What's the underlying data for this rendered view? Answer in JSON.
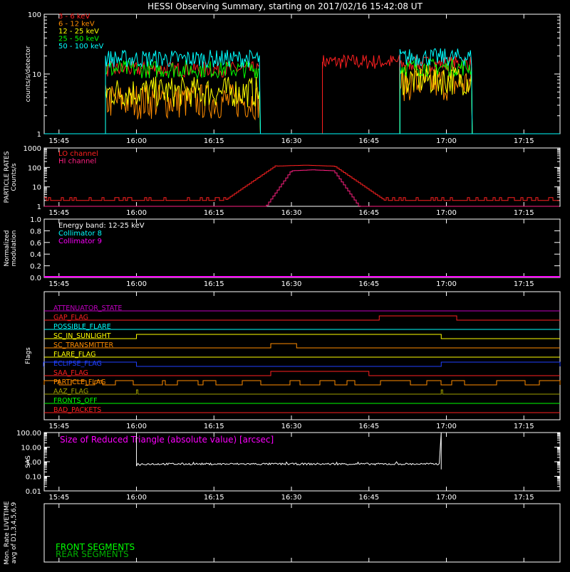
{
  "title": "HESSI Observing Summary, starting on 2017/02/16 15:42:08 UT",
  "time_ticks": [
    "15:45",
    "16:00",
    "16:15",
    "16:30",
    "16:45",
    "17:00",
    "17:15"
  ],
  "colors": {
    "background": "#000000",
    "axis": "#ffffff",
    "e3_6": "#ff2020",
    "e6_12": "#ff8c00",
    "e12_25": "#ffff00",
    "e25_50": "#00ff00",
    "e50_100": "#00ffff",
    "lo": "#ff2020",
    "hi": "#ff2080",
    "sas": "#ff00ff",
    "front": "#00ff00",
    "rear": "#00b000"
  },
  "chart_data": [
    {
      "id": "count_rates",
      "type": "line",
      "ylabel": "counts/s/detector",
      "yscale": "log",
      "ylim": [
        1,
        100
      ],
      "yticks": [
        "1",
        "10",
        "100"
      ],
      "xlim": [
        "15:42:08",
        "17:22:00"
      ],
      "series": [
        {
          "name": "3 - 6 keV",
          "color_key": "e3_6",
          "segments": [
            {
              "start": "16:36",
              "end": "16:51",
              "level": 16
            },
            {
              "start": "16:51",
              "end": "17:05",
              "level": 15
            },
            {
              "start": "15:54",
              "end": "16:24",
              "level": 12
            }
          ]
        },
        {
          "name": "6 - 12 keV",
          "color_key": "e6_12",
          "segments": [
            {
              "start": "15:54",
              "end": "16:24",
              "level": 3.5
            },
            {
              "start": "16:51",
              "end": "17:05",
              "level": 7
            }
          ]
        },
        {
          "name": "12 - 25 keV",
          "color_key": "e12_25",
          "segments": [
            {
              "start": "15:54",
              "end": "16:24",
              "level": 5
            },
            {
              "start": "16:51",
              "end": "17:05",
              "level": 8
            }
          ]
        },
        {
          "name": "25 - 50 keV",
          "color_key": "e25_50",
          "segments": [
            {
              "start": "15:54",
              "end": "16:24",
              "level": 12
            },
            {
              "start": "16:51",
              "end": "17:05",
              "level": 13
            }
          ]
        },
        {
          "name": "50 - 100 keV",
          "color_key": "e50_100",
          "segments": [
            {
              "start": "15:54",
              "end": "16:24",
              "level": 18
            },
            {
              "start": "16:51",
              "end": "17:05",
              "level": 19
            }
          ]
        }
      ]
    },
    {
      "id": "particle_rates",
      "type": "line",
      "ylabel": "PARTICLE RATES\nCounts/s",
      "yscale": "log",
      "ylim": [
        1,
        1000
      ],
      "yticks": [
        "1",
        "10",
        "100",
        "1000"
      ],
      "series": [
        {
          "name": "LO channel",
          "color_key": "lo",
          "baseline": 2,
          "peak": 130,
          "rise_start": "16:17",
          "peak_start": "16:27",
          "peak_end": "16:38",
          "fall_end": "16:48"
        },
        {
          "name": "HI channel",
          "color_key": "hi",
          "baseline": 1,
          "peak": 75,
          "rise_start": "16:25",
          "peak_start": "16:30",
          "peak_end": "16:38",
          "fall_end": "16:43"
        }
      ]
    },
    {
      "id": "modulation",
      "type": "line",
      "ylabel": "Normalized\nmodulation",
      "ylim": [
        0,
        1
      ],
      "yticks": [
        "0.0",
        "0.2",
        "0.4",
        "0.6",
        "0.8",
        "1.0"
      ],
      "legend": [
        "Energy band: 12-25 keV",
        "Collimator 8",
        "Collimator 9"
      ],
      "series": [
        {
          "name": "Collimator 8",
          "color_key": "e50_100",
          "level": 0
        },
        {
          "name": "Collimator 9",
          "color_key": "sas",
          "level": 0
        }
      ]
    },
    {
      "id": "flags",
      "type": "line",
      "ylabel": "Flags",
      "series": [
        {
          "name": "ATTENUATOR_STATE",
          "color": "#c000c0",
          "on": []
        },
        {
          "name": "GAP_FLAG",
          "color": "#ff2020",
          "on": [
            [
              "16:47",
              "17:02"
            ]
          ]
        },
        {
          "name": "POSSIBLE_FLARE",
          "color": "#00ffff",
          "on": []
        },
        {
          "name": "SC_IN_SUNLIGHT",
          "color": "#ffff00",
          "on": [
            [
              "16:00",
              "16:59"
            ]
          ]
        },
        {
          "name": "SC_TRANSMITTER",
          "color": "#ff8c00",
          "on": [
            [
              "16:26",
              "16:31"
            ]
          ]
        },
        {
          "name": "FLARE_FLAG",
          "color": "#ffff00",
          "on": []
        },
        {
          "name": "ECLIPSE_FLAG",
          "color": "#2040ff",
          "on": [
            [
              "15:42",
              "16:00"
            ],
            [
              "16:59",
              "17:22"
            ]
          ]
        },
        {
          "name": "SAA_FLAG",
          "color": "#ff2020",
          "on": [
            [
              "16:26",
              "16:45"
            ]
          ]
        },
        {
          "name": "PARTICLE_FLAG",
          "color": "#ff8c00",
          "on": "intermittent"
        },
        {
          "name": "AAZ_FLAG",
          "color": "#a0a000",
          "on": [
            [
              "16:00",
              "16:00"
            ],
            [
              "16:59",
              "16:59"
            ]
          ]
        },
        {
          "name": "FRONTS_OFF",
          "color": "#00ff00",
          "on": []
        },
        {
          "name": "BAD_PACKETS",
          "color": "#ff2020",
          "on": []
        }
      ]
    },
    {
      "id": "sas",
      "type": "line",
      "ylabel": "SAS",
      "yscale": "log",
      "ylim": [
        0.01,
        100
      ],
      "yticks": [
        "0.01",
        "0.10",
        "1.00",
        "10.00",
        "100.00"
      ],
      "legend": [
        "Size of Reduced Triangle (absolute value) [arcsec]"
      ],
      "series": [
        {
          "name": "Size of Reduced Triangle (absolute value) [arcsec]",
          "color_key": "axis",
          "start": "16:00",
          "end": "16:59",
          "level": 0.7
        }
      ]
    },
    {
      "id": "livetime",
      "type": "line",
      "ylabel": "Mon. Rate LIVETIME\navg of D1,3,4,5,6,9",
      "legend": [
        "FRONT SEGMENTS",
        "REAR SEGMENTS"
      ],
      "series": []
    }
  ]
}
